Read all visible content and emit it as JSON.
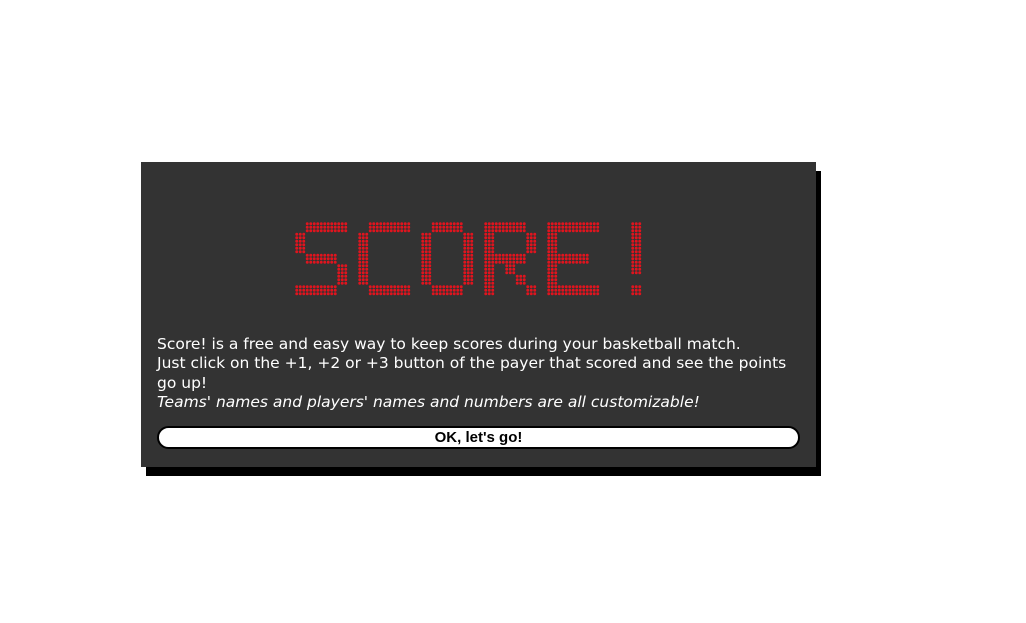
{
  "logo": {
    "text": "SCORE!",
    "led_color": "#e0141e"
  },
  "intro": {
    "line1": "Score! is a free and easy way to keep scores during your basketball match.",
    "line2": "Just click on the +1, +2 or +3 button of the payer that scored and see the points go up!",
    "line3": "Teams' names and players' names and numbers are all customizable!"
  },
  "actions": {
    "ok_label": "OK, let's go!"
  },
  "colors": {
    "dialog_bg": "#333333",
    "shadow": "#000000",
    "text": "#ffffff"
  }
}
